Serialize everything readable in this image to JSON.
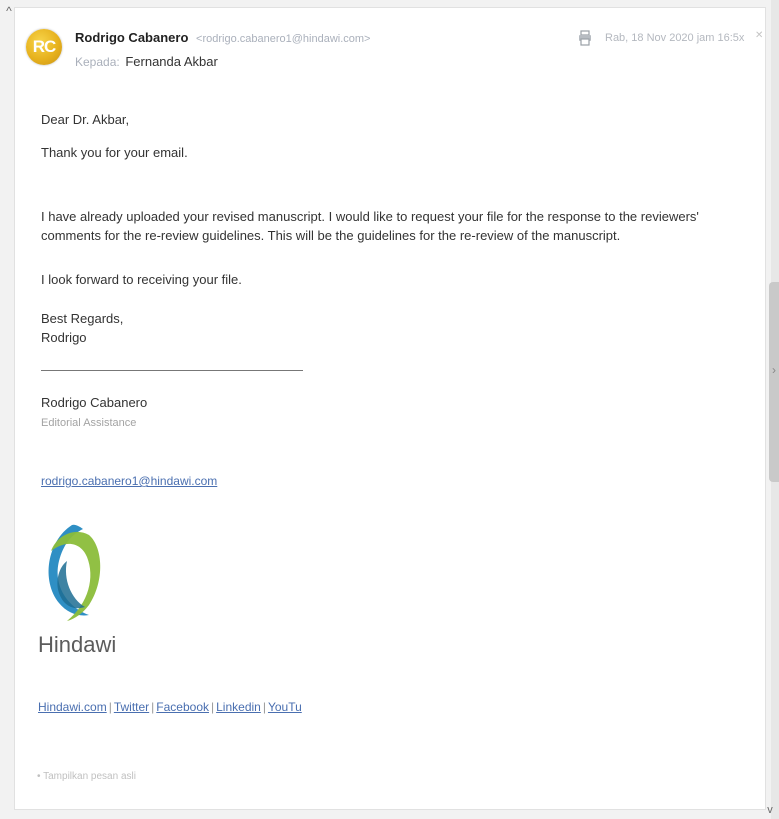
{
  "header": {
    "avatar_initials": "RC",
    "sender_name": "Rodrigo Cabanero",
    "sender_email": "<rodrigo.cabanero1@hindawi.com>",
    "to_label": "Kepada:",
    "to_name": "Fernanda Akbar",
    "date": "Rab, 18 Nov 2020 jam 16:5x"
  },
  "body": {
    "greeting": "Dear Dr. Akbar,",
    "line1": "Thank you for your email.",
    "line2": "I have already uploaded your revised manuscript. I would like to request your file for the response to the reviewers' comments for the re-review guidelines. This will be the guidelines for the re-review of the manuscript.",
    "line3": "I look forward to receiving your file.",
    "closing": "Best Regards,",
    "signoff": "Rodrigo"
  },
  "signature": {
    "name": "Rodrigo Cabanero",
    "role": "Editorial Assistance",
    "email": "rodrigo.cabanero1@hindawi.com",
    "brand": "Hindawi",
    "links": [
      "Hindawi.com",
      "Twitter",
      "Facebook",
      "Linkedin",
      "YouTu"
    ]
  },
  "footer": {
    "show_original": "Tampilkan pesan asli"
  },
  "icons": {
    "print": "printer-icon",
    "close": "close-icon",
    "scroll_up": "chevron-up-icon",
    "scroll_down": "chevron-down-icon"
  },
  "colors": {
    "link": "#4a6fb0",
    "avatar": "#e7b21e",
    "logo_blue": "#2f8fc4",
    "logo_green": "#8bbd3a"
  }
}
